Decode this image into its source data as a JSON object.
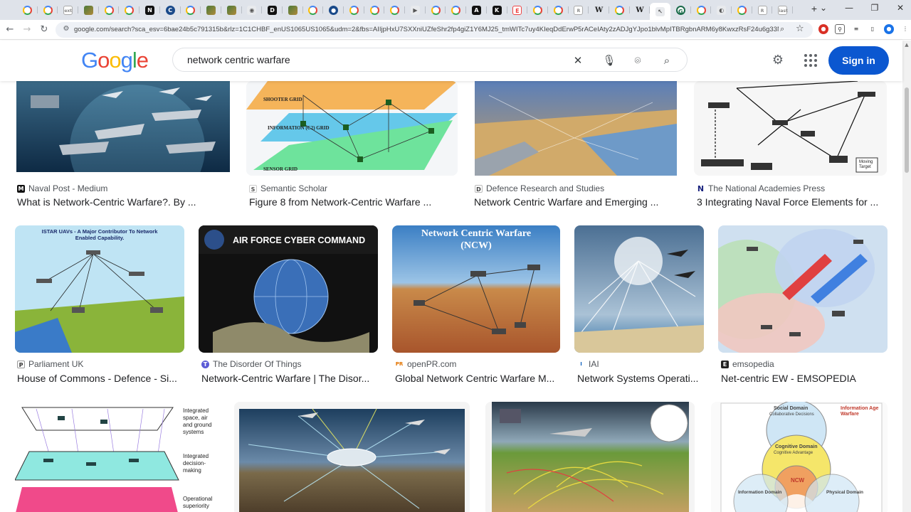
{
  "browser": {
    "tabs": [
      {
        "icon": "google-favicon",
        "kind": "g"
      },
      {
        "icon": "google-favicon",
        "kind": "g"
      },
      {
        "icon": "extension-favicon",
        "kind": "ext",
        "glyph": "ext"
      },
      {
        "icon": "image-favicon",
        "kind": "img"
      },
      {
        "icon": "google-favicon",
        "kind": "g"
      },
      {
        "icon": "google-favicon",
        "kind": "g"
      },
      {
        "icon": "dark-favicon",
        "kind": "dark",
        "glyph": "N"
      },
      {
        "icon": "globe-favicon",
        "kind": "blue",
        "glyph": "C"
      },
      {
        "icon": "google-favicon",
        "kind": "g"
      },
      {
        "icon": "image-favicon",
        "kind": "img"
      },
      {
        "icon": "image-favicon",
        "kind": "img"
      },
      {
        "icon": "pinned-favicon",
        "kind": "pin",
        "glyph": "◉"
      },
      {
        "icon": "dark-favicon",
        "kind": "dark",
        "glyph": "D"
      },
      {
        "icon": "image-favicon",
        "kind": "img"
      },
      {
        "icon": "google-favicon",
        "kind": "g"
      },
      {
        "icon": "globe-favicon",
        "kind": "blue",
        "glyph": "●"
      },
      {
        "icon": "google-favicon",
        "kind": "g"
      },
      {
        "icon": "google-favicon",
        "kind": "g"
      },
      {
        "icon": "google-favicon",
        "kind": "g"
      },
      {
        "icon": "arrow-favicon",
        "kind": "pin",
        "glyph": "▶"
      },
      {
        "icon": "google-favicon",
        "kind": "g"
      },
      {
        "icon": "google-favicon",
        "kind": "g"
      },
      {
        "icon": "dark-favicon",
        "kind": "dark",
        "glyph": "A"
      },
      {
        "icon": "dark-favicon",
        "kind": "dark",
        "glyph": "K"
      },
      {
        "icon": "red-favicon",
        "kind": "red",
        "glyph": "E"
      },
      {
        "icon": "google-favicon",
        "kind": "g"
      },
      {
        "icon": "google-favicon",
        "kind": "g"
      },
      {
        "icon": "extension-favicon",
        "kind": "ext",
        "glyph": "R"
      },
      {
        "icon": "wikipedia-favicon",
        "kind": "w",
        "glyph": "W"
      },
      {
        "icon": "google-favicon",
        "kind": "g"
      },
      {
        "icon": "wikipedia-favicon",
        "kind": "w",
        "glyph": "W"
      },
      {
        "icon": "active-page-favicon",
        "kind": "pin",
        "glyph": "↖",
        "active": true
      },
      {
        "icon": "green-favicon",
        "kind": "green",
        "glyph": "G"
      },
      {
        "icon": "google-favicon",
        "kind": "g"
      },
      {
        "icon": "globe-favicon",
        "kind": "pin",
        "glyph": "◐"
      },
      {
        "icon": "google-favicon",
        "kind": "g"
      },
      {
        "icon": "extension-favicon",
        "kind": "ext",
        "glyph": "R"
      },
      {
        "icon": "extension-favicon",
        "kind": "ext",
        "glyph": "iast"
      }
    ],
    "url": "google.com/search?sca_esv=6bae24b5c791315b&rlz=1C1CHBF_enUS1065US1065&udm=2&fbs=AIIjpHxU7SXXniUZfeShr2fp4giZ1Y6MJ25_tmWITc7uy4KIeqDdErwP5rACeIAty2zADJgYJpo1blvMpITBRgbnARM6y8KwxzRsF24u6g33Nut8Qg5o..."
  },
  "search": {
    "logo_letters": [
      "G",
      "o",
      "o",
      "g",
      "l",
      "e"
    ],
    "query": "network centric warfare",
    "signin_label": "Sign in"
  },
  "results": [
    {
      "source": "Naval Post - Medium",
      "caption": "What is Network-Centric Warfare?. By ...",
      "source_icon": "M"
    },
    {
      "source": "Semantic Scholar",
      "caption": "Figure 8 from Network-Centric Warfare ...",
      "source_icon": "S",
      "thumb_labels": [
        "SHOOTER GRID",
        "INFORMATION (C2) GRID",
        "SENSOR GRID"
      ]
    },
    {
      "source": "Defence Research and Studies",
      "caption": "Network Centric Warfare and Emerging ...",
      "source_icon": "D"
    },
    {
      "source": "The National Academies Press",
      "caption": "3 Integrating Naval Force Elements for ...",
      "source_icon": "N",
      "thumb_labels": [
        "Moving Target"
      ]
    },
    {
      "source": "Parliament UK",
      "caption": "House of Commons - Defence - Si...",
      "source_icon": "P",
      "thumb_labels": [
        "ISTAR UAVs - A Major Contributor To Network Enabled Capability."
      ]
    },
    {
      "source": "The Disorder Of Things",
      "caption": "Network-Centric Warfare | The Disor...",
      "source_icon": "T",
      "thumb_labels": [
        "AIR FORCE CYBER COMMAND"
      ]
    },
    {
      "source": "openPR.com",
      "caption": "Global Network Centric Warfare M...",
      "source_icon": "PR",
      "thumb_labels": [
        "Network Centric Warfare",
        "(NCW)"
      ]
    },
    {
      "source": "IAI",
      "caption": "Network Systems Operati...",
      "source_icon": "I"
    },
    {
      "source": "emsopedia",
      "caption": "Net-centric EW - EMSOPEDIA",
      "source_icon": "E"
    },
    {
      "thumb_labels": [
        "Integrated space, air and ground systems",
        "Integrated decision-making",
        "Operational superiority"
      ]
    },
    {},
    {},
    {
      "thumb_labels": [
        "Social Domain",
        "Collaborative Decisions",
        "Information Age Warfare",
        "Cognitive Domain",
        "Cognitive Advantage",
        "NCW",
        "Information Domain",
        "Physical Domain"
      ]
    }
  ]
}
